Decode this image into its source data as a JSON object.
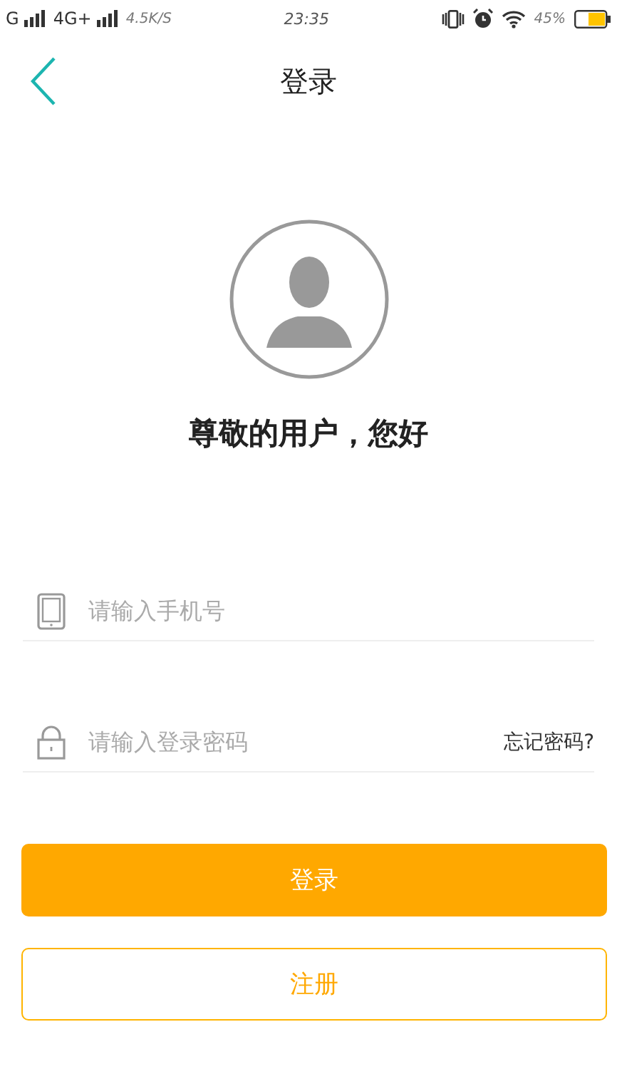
{
  "status_bar": {
    "carrier1": "G",
    "carrier2": "4G+",
    "speed": "4.5K/S",
    "time": "23:35",
    "battery": "45%"
  },
  "header": {
    "title": "登录"
  },
  "greeting": "尊敬的用户，您好",
  "fields": [
    {
      "kind": "phone",
      "placeholder": "请输入手机号"
    },
    {
      "kind": "password",
      "placeholder": "请输入登录密码",
      "link": "忘记密码?"
    }
  ],
  "buttons": [
    {
      "kind": "primary",
      "label": "登录"
    },
    {
      "kind": "outline",
      "label": "注册"
    }
  ]
}
